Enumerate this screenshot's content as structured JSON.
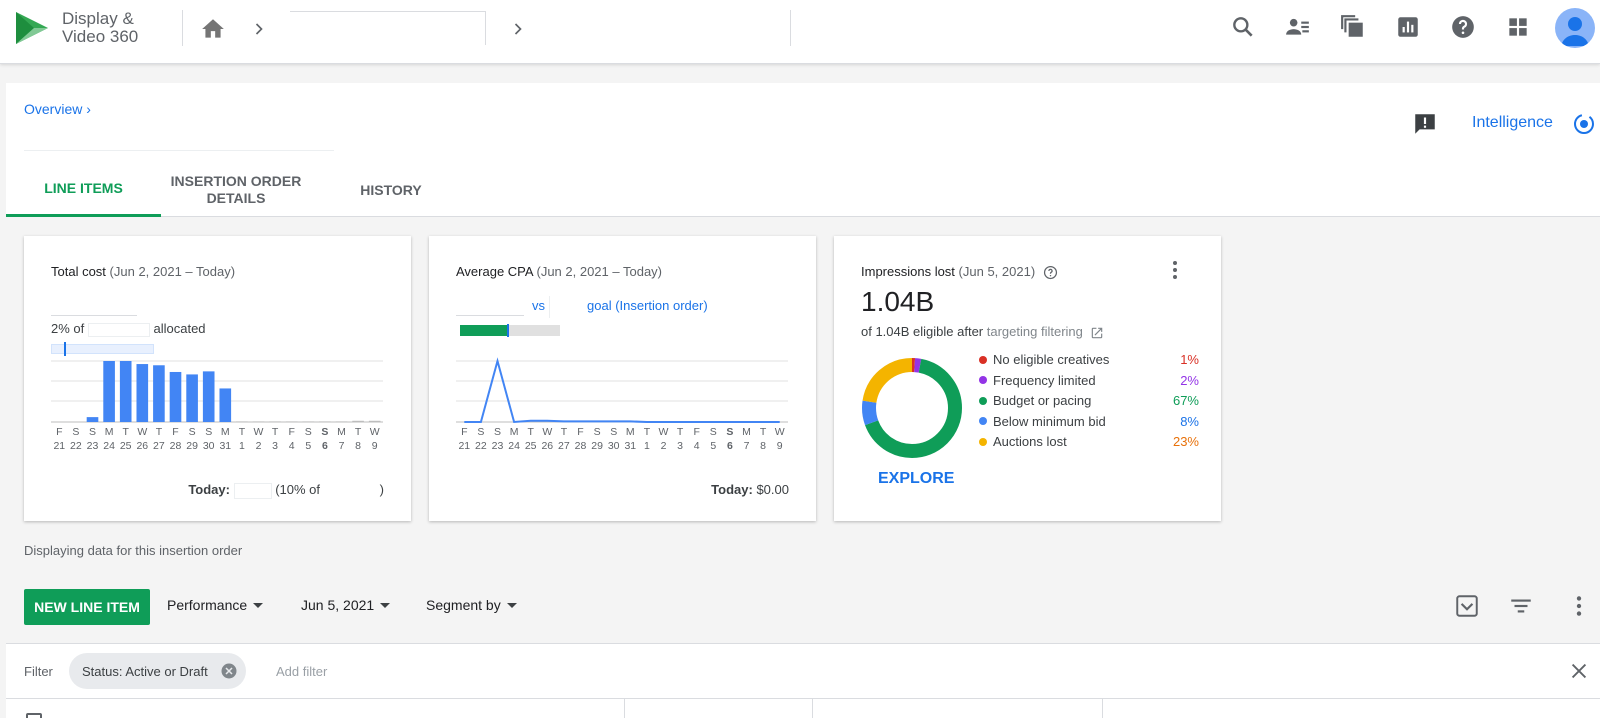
{
  "app": {
    "name_line1": "Display &",
    "name_line2": "Video 360"
  },
  "topbar": {
    "icons": [
      "home-icon",
      "chevron-right-icon",
      "search-icon",
      "people-icon",
      "copy-icon",
      "reports-icon",
      "help-icon",
      "apps-grid-icon",
      "avatar"
    ]
  },
  "page": {
    "breadcrumb_overview": "Overview ›",
    "intelligence_label": "Intelligence",
    "tabs": [
      {
        "line1": "LINE ITEMS",
        "line2": ""
      },
      {
        "line1": "INSERTION ORDER",
        "line2": "DETAILS"
      },
      {
        "line1": "HISTORY",
        "line2": ""
      }
    ],
    "active_tab": 0
  },
  "cards": {
    "total_cost": {
      "title": "Total cost",
      "range": "(Jun 2, 2021 – Today)",
      "budget_prefix": "2% of",
      "budget_suffix": "allocated",
      "budget_progress_pct": 2,
      "today_label": "Today:",
      "today_paren_open": "(10% of",
      "today_paren_close": ")"
    },
    "avg_cpa": {
      "title": "Average CPA",
      "range": "(Jun 2, 2021 – Today)",
      "vs_label": "vs",
      "goal_label": "goal (Insertion order)",
      "goal_progress_pct": 48,
      "today_label": "Today:",
      "today_value": "$0.00"
    },
    "impressions_lost": {
      "title": "Impressions lost",
      "range": "(Jun 5, 2021)",
      "value": "1.04B",
      "eligible_prefix": "of 1.04B eligible after",
      "eligible_link": "targeting filtering",
      "explore_label": "EXPLORE"
    }
  },
  "chart_data": [
    {
      "type": "bar",
      "title": "Total cost",
      "categories": [
        "F 21",
        "S 22",
        "S 23",
        "M 24",
        "T 25",
        "W 26",
        "T 27",
        "F 28",
        "S 29",
        "S 30",
        "M 31",
        "T 1",
        "W 2",
        "T 3",
        "F 4",
        "S 5",
        "S 6",
        "M 7",
        "T 8",
        "W 9"
      ],
      "values": [
        0,
        0,
        0.08,
        1.0,
        1.0,
        0.95,
        0.93,
        0.82,
        0.78,
        0.83,
        0.55,
        0.01,
        0.01,
        0.01,
        0.01,
        0.01,
        0.01,
        0.01,
        0.02,
        0.02
      ],
      "x_top": [
        "F",
        "S",
        "S",
        "M",
        "T",
        "W",
        "T",
        "F",
        "S",
        "S",
        "M",
        "T",
        "W",
        "T",
        "F",
        "S",
        "S",
        "M",
        "T",
        "W"
      ],
      "x_bottom": [
        "21",
        "22",
        "23",
        "24",
        "25",
        "26",
        "27",
        "28",
        "29",
        "30",
        "31",
        "1",
        "2",
        "3",
        "4",
        "5",
        "6",
        "7",
        "8",
        "9"
      ],
      "bold_index": 16,
      "ylim": [
        0,
        1.0
      ]
    },
    {
      "type": "line",
      "title": "Average CPA",
      "categories": [
        "F 21",
        "S 22",
        "S 23",
        "M 24",
        "T 25",
        "W 26",
        "T 27",
        "F 28",
        "S 29",
        "S 30",
        "M 31",
        "T 1",
        "W 2",
        "T 3",
        "F 4",
        "S 5",
        "S 6",
        "M 7",
        "T 8",
        "W 9"
      ],
      "values": [
        0,
        0,
        1.0,
        0,
        0.02,
        0.02,
        0.01,
        0.01,
        0.01,
        0.01,
        0.01,
        0,
        0,
        0,
        0,
        0,
        0,
        0,
        0,
        0
      ],
      "x_top": [
        "F",
        "S",
        "S",
        "M",
        "T",
        "W",
        "T",
        "F",
        "S",
        "S",
        "M",
        "T",
        "W",
        "T",
        "F",
        "S",
        "S",
        "M",
        "T",
        "W"
      ],
      "x_bottom": [
        "21",
        "22",
        "23",
        "24",
        "25",
        "26",
        "27",
        "28",
        "29",
        "30",
        "31",
        "1",
        "2",
        "3",
        "4",
        "5",
        "6",
        "7",
        "8",
        "9"
      ],
      "bold_index": 16,
      "ylim": [
        0,
        1.0
      ]
    },
    {
      "type": "pie",
      "title": "Impressions lost",
      "series": [
        {
          "name": "No eligible creatives",
          "label": "1%",
          "value": 1,
          "color": "#d93025"
        },
        {
          "name": "Frequency limited",
          "label": "2%",
          "value": 2,
          "color": "#9334e6"
        },
        {
          "name": "Budget or pacing",
          "label": "67%",
          "value": 67,
          "color": "#0f9d58"
        },
        {
          "name": "Below minimum bid",
          "label": "8%",
          "value": 8,
          "color": "#4285f4"
        },
        {
          "name": "Auctions lost",
          "label": "23%",
          "value": 23,
          "color": "#f4b400"
        }
      ]
    }
  ],
  "pct_colors": [
    "#d93025",
    "#9334e6",
    "#0f9d58",
    "#1a73e8",
    "#e8710a"
  ],
  "displaying_text": "Displaying data for this insertion order",
  "toolbar": {
    "new_line_item": "NEW LINE ITEM",
    "performance": "Performance",
    "date": "Jun 5, 2021",
    "segment_by": "Segment by"
  },
  "filter": {
    "label": "Filter",
    "chip": "Status: Active or Draft",
    "add_placeholder": "Add filter"
  },
  "colors": {
    "accent_green": "#0f9d58",
    "link_blue": "#1a73e8",
    "bar_blue": "#4285f4"
  }
}
